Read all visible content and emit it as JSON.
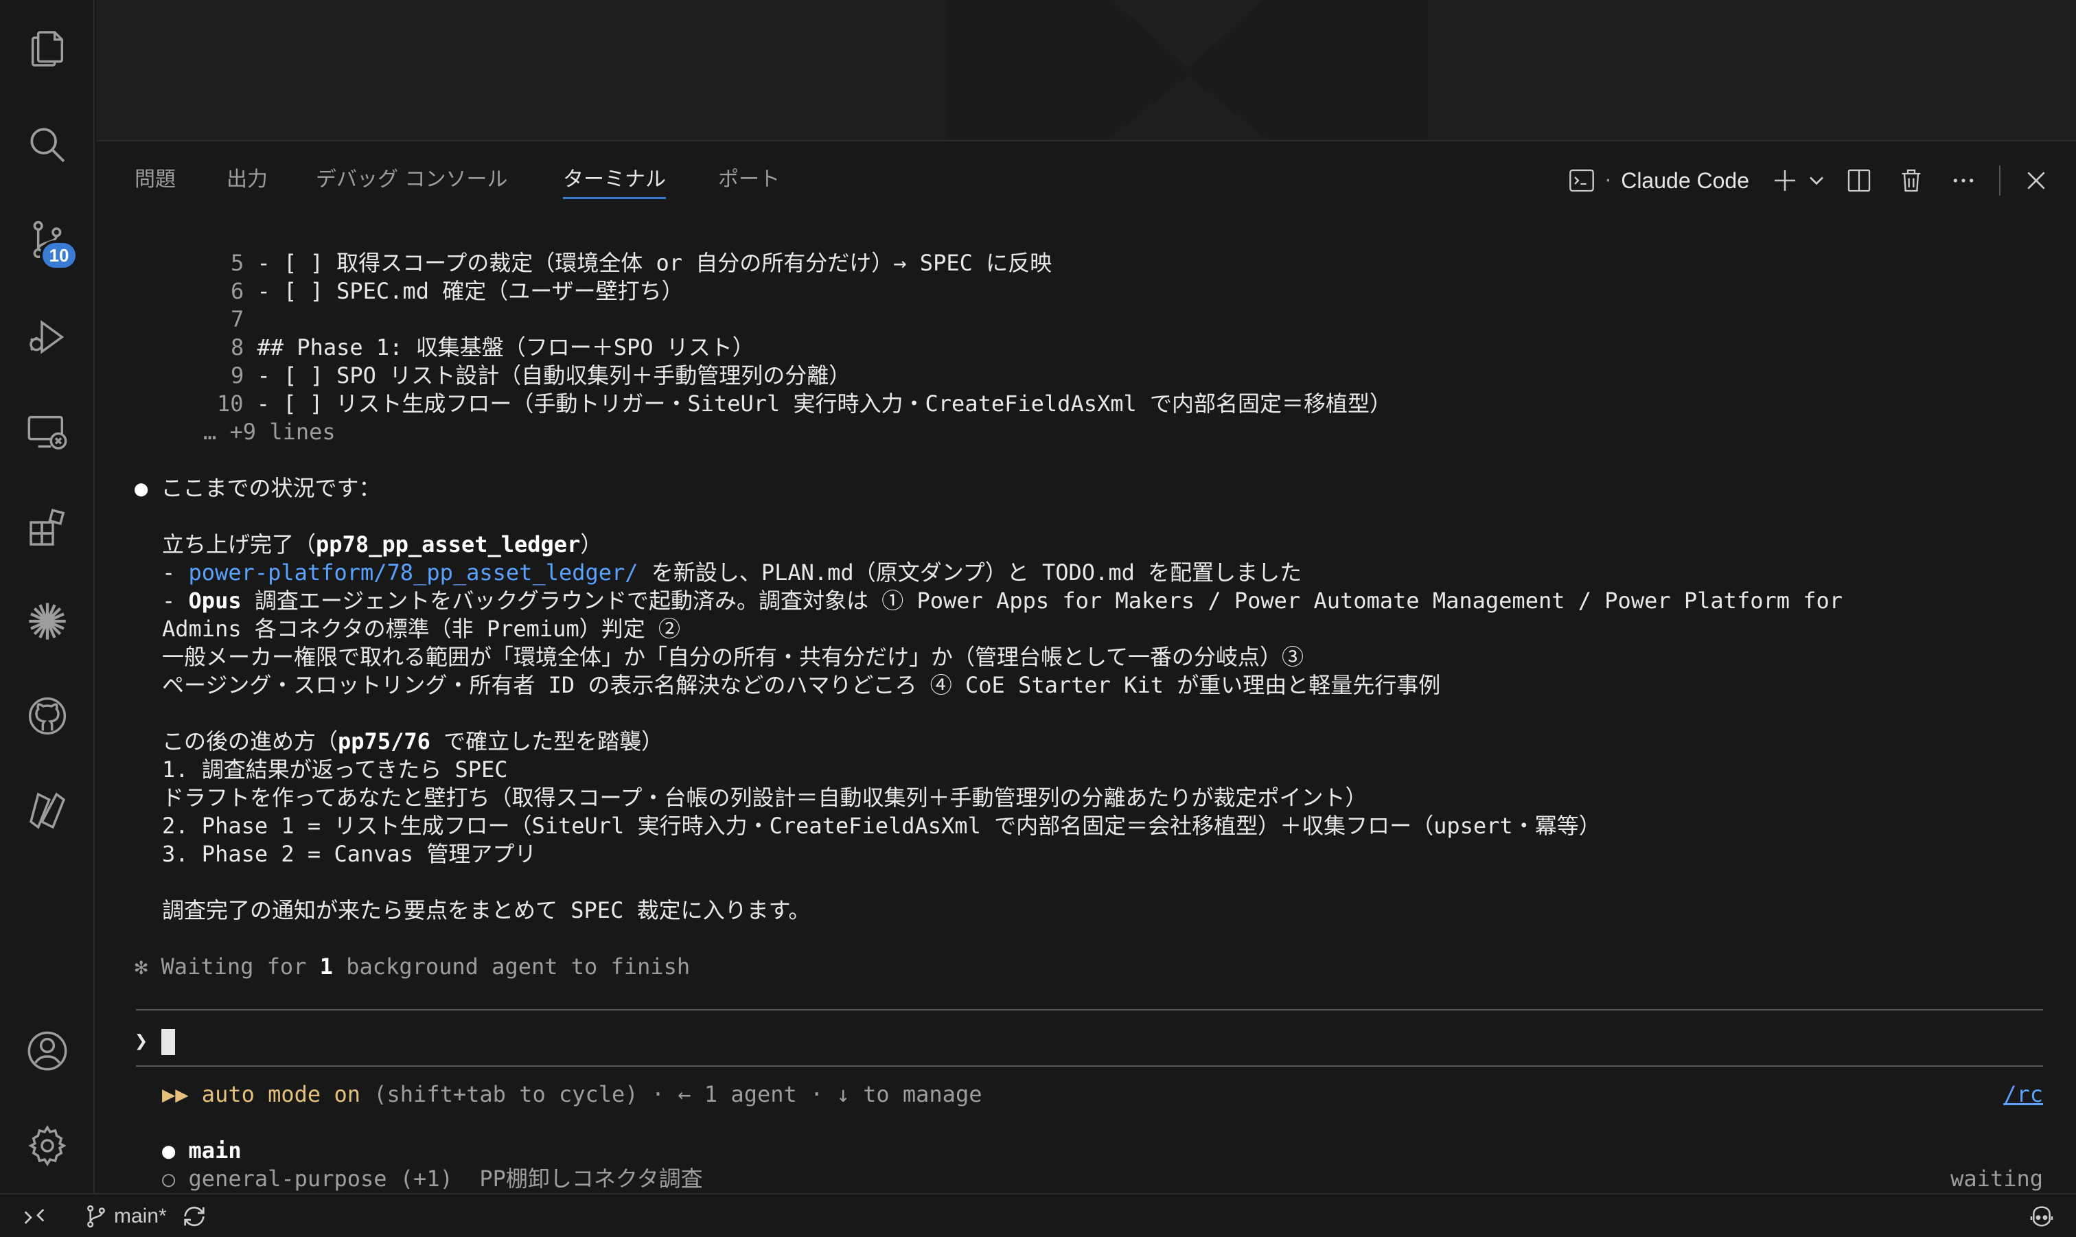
{
  "activity_bar": {
    "items": [
      {
        "icon": "files-icon"
      },
      {
        "icon": "search-icon"
      },
      {
        "icon": "source-control-icon"
      },
      {
        "icon": "run-debug-icon"
      },
      {
        "icon": "remote-explorer-icon"
      },
      {
        "icon": "extensions-icon"
      },
      {
        "icon": "claude-icon"
      },
      {
        "icon": "github-icon"
      },
      {
        "icon": "power-platform-icon"
      }
    ],
    "scm_badge": "10",
    "bottom": [
      {
        "icon": "account-icon"
      },
      {
        "icon": "gear-icon"
      }
    ]
  },
  "panel": {
    "tabs": [
      {
        "label": "問題"
      },
      {
        "label": "出力"
      },
      {
        "label": "デバッグ コンソール"
      },
      {
        "label": "ターミナル",
        "active": true
      },
      {
        "label": "ポート"
      }
    ],
    "terminal_name": "Claude Code",
    "separator": "·"
  },
  "terminal": {
    "diff_lines": [
      {
        "num": "5",
        "text": "- [ ] 取得スコープの裁定（環境全体 or 自分の所有分だけ）→ SPEC に反映"
      },
      {
        "num": "6",
        "text": "- [ ] SPEC.md 確定（ユーザー壁打ち）"
      },
      {
        "num": "7",
        "text": ""
      },
      {
        "num": "8",
        "text": "## Phase 1: 収集基盤（フロー＋SPO リスト）"
      },
      {
        "num": "9",
        "text": "- [ ] SPO リスト設計（自動収集列＋手動管理列の分離）"
      },
      {
        "num": "10",
        "text": "- [ ] リスト生成フロー（手動トリガー・SiteUrl 実行時入力・CreateFieldAsXml で内部名固定＝移植型）"
      }
    ],
    "more_lines": "… +9 lines",
    "bullet": "●",
    "status_heading": "ここまでの状況です：",
    "section1_title_pre": "立ち上げ完了（",
    "section1_title_bold": "pp78_pp_asset_ledger",
    "section1_title_post": "）",
    "line_folder_dash": "- ",
    "line_folder_link": "power-platform/78_pp_asset_ledger/",
    "line_folder_rest": " を新設し、PLAN.md（原文ダンプ）と TODO.md を配置しました",
    "line_opus_dash": "- ",
    "line_opus_bold": "Opus",
    "line_opus_rest": " 調査エージェントをバックグラウンドで起動済み。調査対象は ① Power Apps for Makers / Power Automate Management / Power Platform for",
    "line_opus_wrap": "Admins 各コネクタの標準（非 Premium）判定 ②",
    "line_scope": "一般メーカー権限で取れる範囲が「環境全体」か「自分の所有・共有分だけ」か（管理台帳として一番の分岐点）③",
    "line_paging": "ページング・スロットリング・所有者 ID の表示名解決などのハマりどころ ④ CoE Starter Kit が重い理由と軽量先行事例",
    "section2_title_pre": "この後の進め方（",
    "section2_title_bold": "pp75/76",
    "section2_title_post": " で確立した型を踏襲）",
    "step1": "1. 調査結果が返ってきたら SPEC",
    "step1_wrap": "ドラフトを作ってあなたと壁打ち（取得スコープ・台帳の列設計＝自動収集列＋手動管理列の分離あたりが裁定ポイント）",
    "step2": "2. Phase 1 = リスト生成フロー（SiteUrl 実行時入力・CreateFieldAsXml で内部名固定＝会社移植型）＋収集フロー（upsert・冪等）",
    "step3": "3. Phase 2 = Canvas 管理アプリ",
    "closing": "調査完了の通知が来たら要点をまとめて SPEC 裁定に入ります。",
    "waiting_star": "✻",
    "waiting_pre": " Waiting for ",
    "waiting_bold": "1",
    "waiting_post": " background agent to finish",
    "prompt": "❯",
    "mode_arrows": "▶▶",
    "mode_label": " auto mode on",
    "mode_hint": " (shift+tab to cycle) · ← 1 agent · ↓ to manage",
    "rc_link": "/rc",
    "agent_main_bullet": "●",
    "agent_main": "main",
    "agent_sub_bullet": "○",
    "agent_sub": "general-purpose (+1)  PP棚卸しコネクタ調査",
    "agent_status": "waiting"
  },
  "status_bar": {
    "branch": "main*"
  }
}
